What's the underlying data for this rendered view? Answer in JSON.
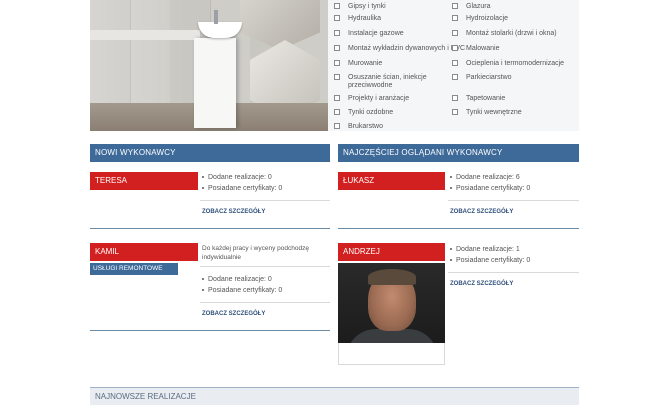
{
  "categories": [
    [
      "Gipsy i tynki",
      "Glazura"
    ],
    [
      "Hydraulika",
      "Hydroizolacje"
    ],
    [
      "Instalacje gazowe",
      "Montaż stolarki (drzwi i okna)"
    ],
    [
      "Montaż wykładzin dywanowych i PVC",
      "Malowanie"
    ],
    [
      "Murowanie",
      "Ocieplenia i termomodernizacje"
    ],
    [
      "Osuszanie ścian, iniekcje przeciwwodne",
      "Parkieciarstwo"
    ],
    [
      "Projekty i aranżacje",
      "Tapetowanie"
    ],
    [
      "Tynki ozdobne",
      "Tynki wewnętrzne"
    ],
    [
      "Brukarstwo",
      ""
    ]
  ],
  "sections": {
    "new": "NOWI WYKONAWCY",
    "popular": "NAJCZĘŚCIEJ OGLĄDANI WYKONAWCY",
    "latest": "NAJNOWSZE REALIZACJE"
  },
  "contractors": {
    "teresa": {
      "name": "TERESA",
      "realizations": "Dodane realizacje: 0",
      "certificates": "Posiadane certyfikaty: 0",
      "more": "ZOBACZ SZCZEGÓŁY"
    },
    "lukasz": {
      "name": "ŁUKASZ",
      "realizations": "Dodane realizacje: 6",
      "certificates": "Posiadane certyfikaty: 0",
      "more": "ZOBACZ SZCZEGÓŁY"
    },
    "kamil": {
      "name": "KAMIL",
      "tag": "USŁUGI REMONTOWE",
      "description": "Do każdej pracy i wyceny podchodzę indywidualnie",
      "realizations": "Dodane realizacje: 0",
      "certificates": "Posiadane certyfikaty: 0",
      "more": "ZOBACZ SZCZEGÓŁY"
    },
    "andrzej": {
      "name": "ANDRZEJ",
      "realizations": "Dodane realizacje: 1",
      "certificates": "Posiadane certyfikaty: 0",
      "more": "ZOBACZ SZCZEGÓŁY"
    }
  },
  "colors": {
    "header_blue": "#3e6a9a",
    "name_red": "#d21f1f",
    "link": "#2d4e7a"
  }
}
